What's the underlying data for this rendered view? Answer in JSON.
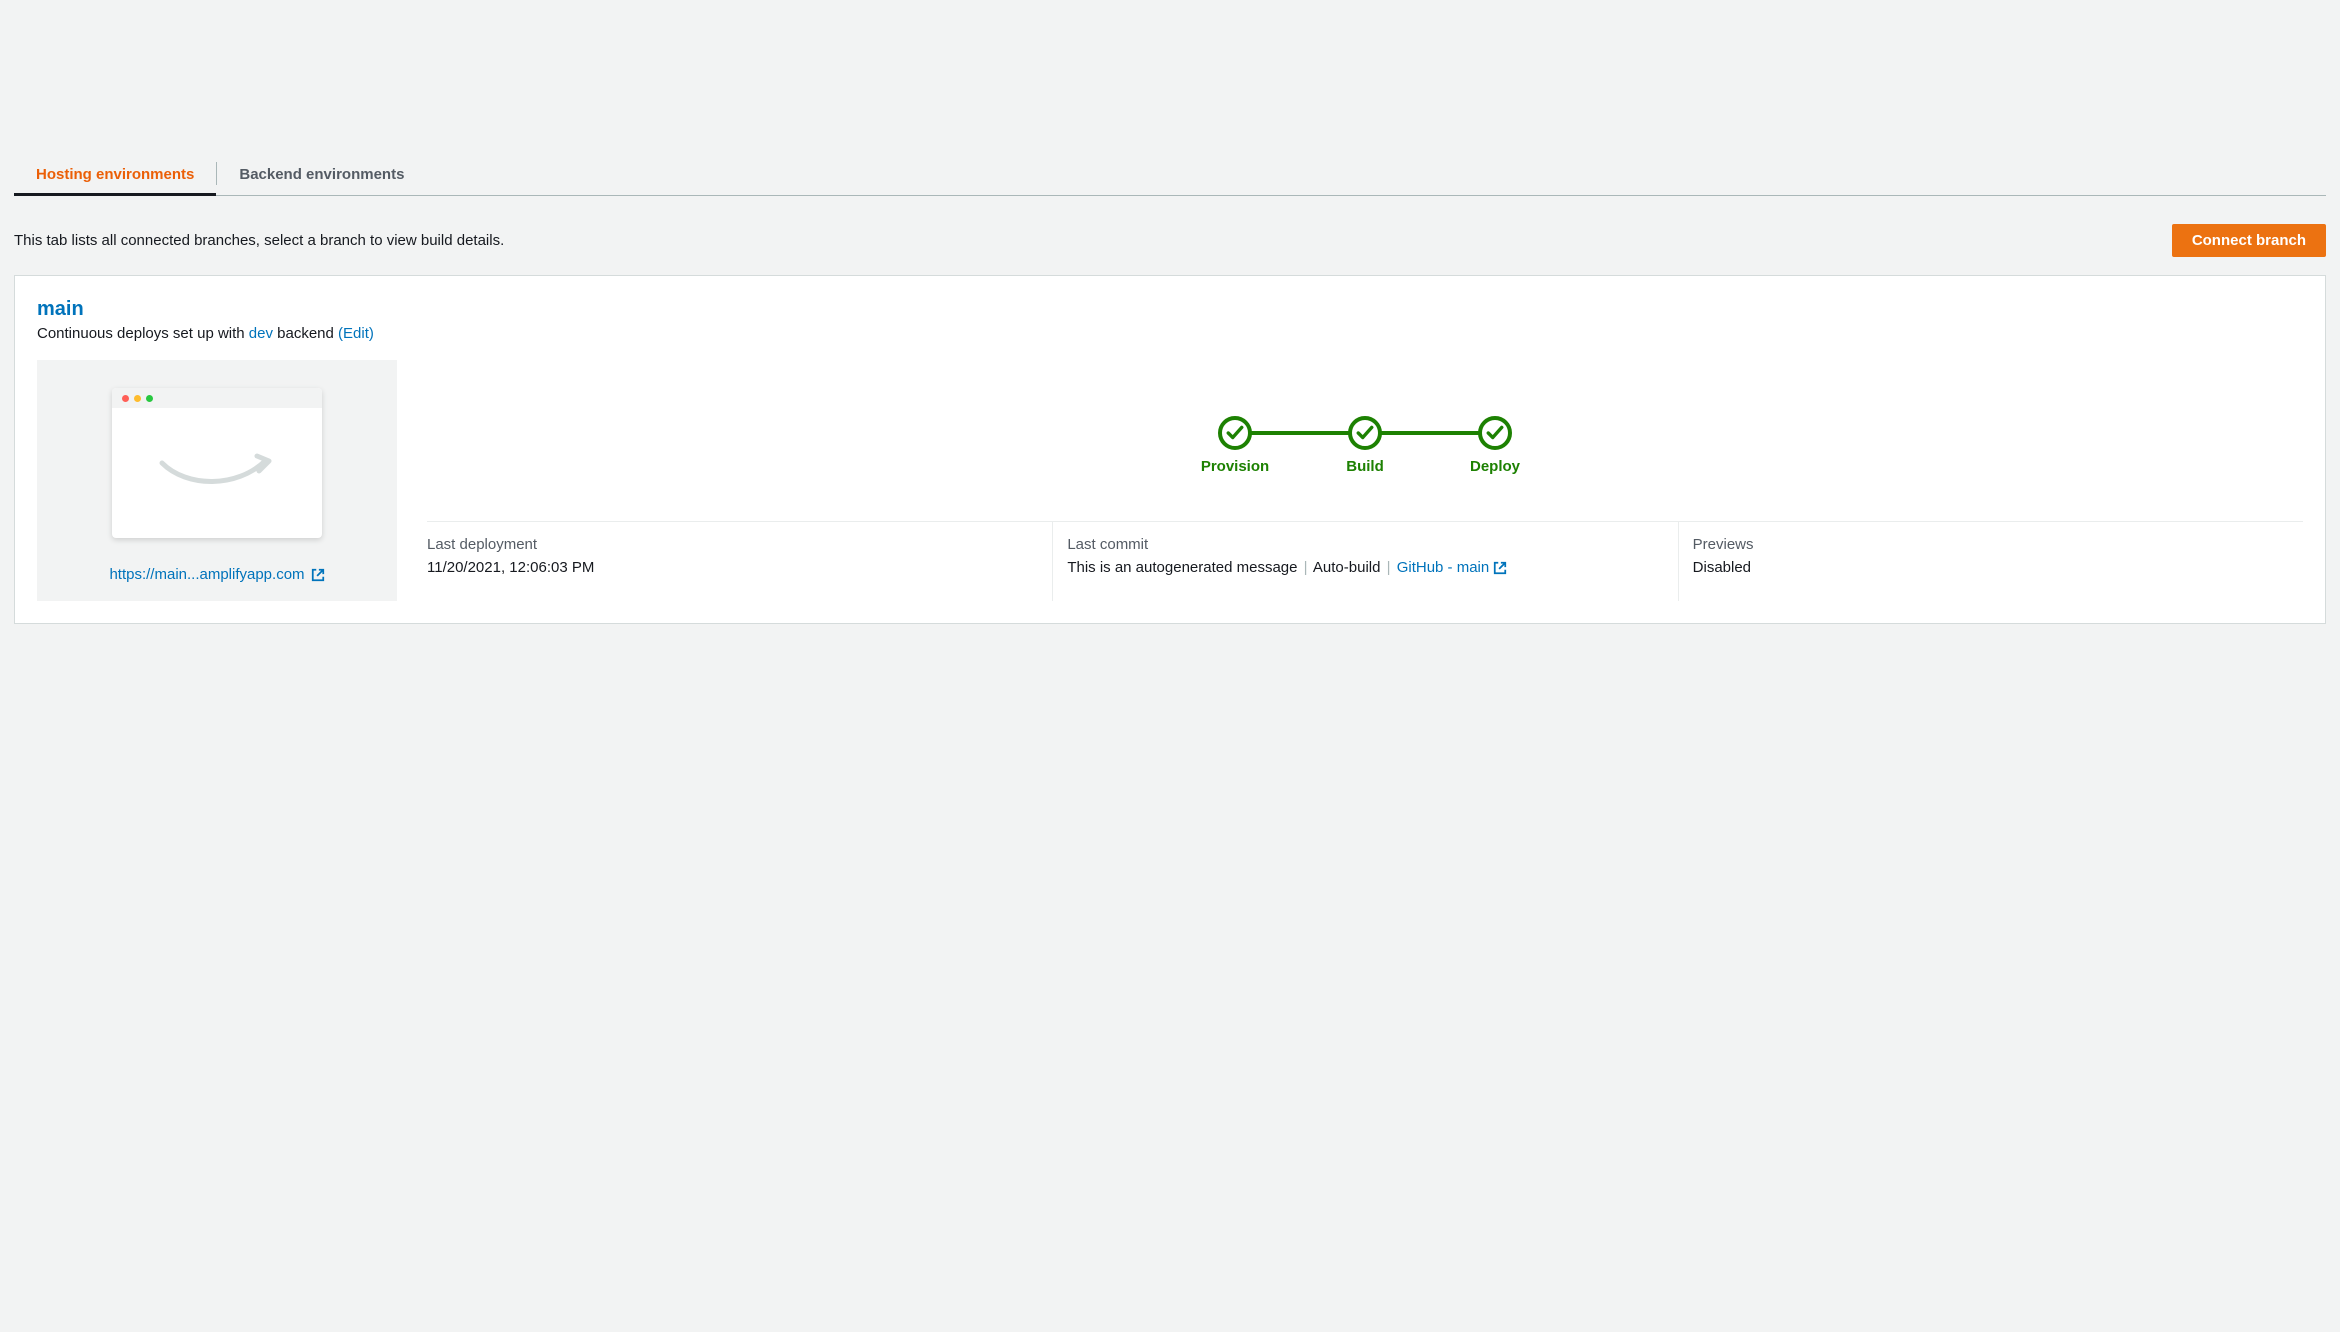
{
  "tabs": [
    {
      "label": "Hosting environments",
      "active": true
    },
    {
      "label": "Backend environments",
      "active": false
    }
  ],
  "toolbar": {
    "description": "This tab lists all connected branches, select a branch to view build details.",
    "connect_button": "Connect branch"
  },
  "branch": {
    "name": "main",
    "subtitle_prefix": "Continuous deploys set up with ",
    "backend_name": "dev",
    "subtitle_suffix": " backend ",
    "edit_label": "(Edit)",
    "preview_url_text": "https://main...amplifyapp.com",
    "pipeline": [
      {
        "label": "Provision",
        "status": "success"
      },
      {
        "label": "Build",
        "status": "success"
      },
      {
        "label": "Deploy",
        "status": "success"
      }
    ],
    "info": {
      "last_deployment": {
        "label": "Last deployment",
        "value": "11/20/2021, 12:06:03 PM"
      },
      "last_commit": {
        "label": "Last commit",
        "message": "This is an autogenerated message",
        "auto_build": "Auto-build",
        "source_link": "GitHub - main"
      },
      "previews": {
        "label": "Previews",
        "value": "Disabled"
      }
    }
  }
}
